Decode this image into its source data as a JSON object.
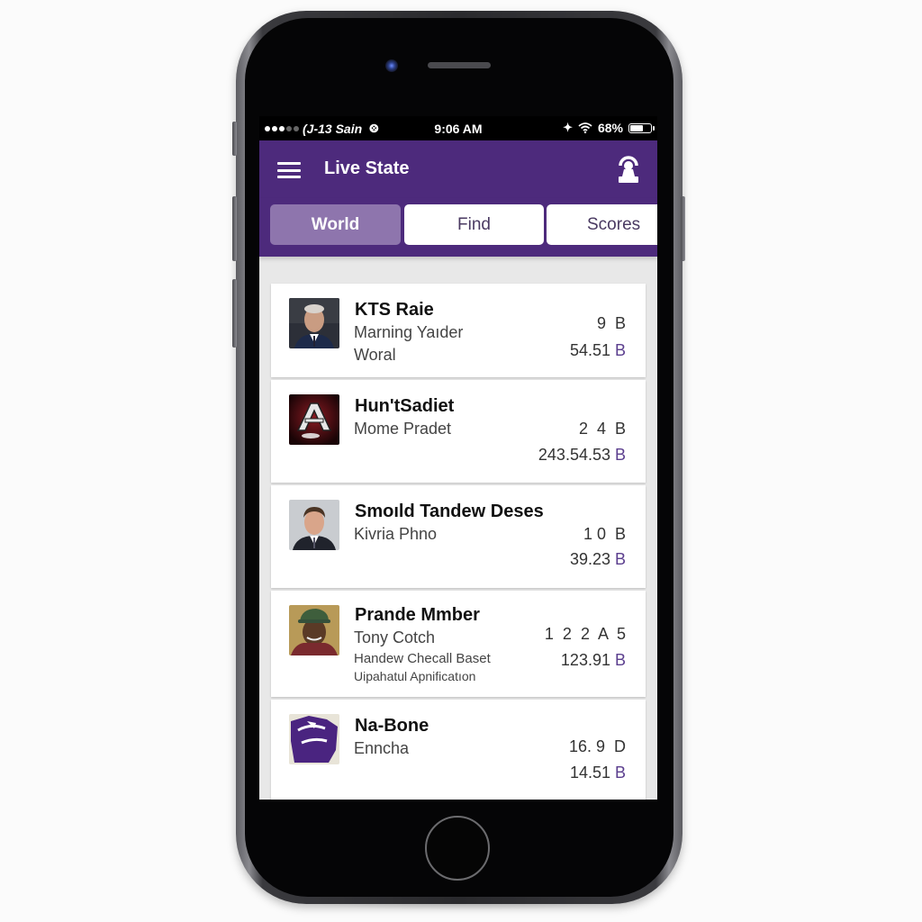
{
  "status_bar": {
    "signal_dots_full": 3,
    "signal_dots_total": 5,
    "carrier": "(J-13 Sain",
    "time": "9:06 AM",
    "battery_percent": "68%",
    "battery_level": 0.68
  },
  "app_bar": {
    "title": "Live State",
    "menu_icon": "hamburger-menu-icon",
    "right_icon": "profile-icon"
  },
  "tabs": [
    {
      "label": "World",
      "active": true
    },
    {
      "label": "Find",
      "active": false
    },
    {
      "label": "Scores",
      "active": false
    }
  ],
  "items": [
    {
      "title": "KTS Raie",
      "subtitle": "Marning Yaıder",
      "line3": "Woral",
      "line4": "",
      "stat_top": "9  ",
      "stat_top_unit": "B",
      "stat_bottom": "54.51 ",
      "stat_bottom_unit": "B",
      "avatar": "man-in-suit-photo"
    },
    {
      "title": "Hun'tSadiet",
      "subtitle": "Mome Pradet",
      "line3": "",
      "line4": "",
      "stat_top": "2  4  ",
      "stat_top_unit": "B",
      "stat_bottom": "243.54.53 ",
      "stat_bottom_unit": "B",
      "avatar": "team-logo-letter-a"
    },
    {
      "title": "Smoıld Tandew Deses",
      "subtitle": "Kivria Phno",
      "line3": "",
      "line4": "",
      "stat_top": "1 0  ",
      "stat_top_unit": "B",
      "stat_bottom": "39.23 ",
      "stat_bottom_unit": "B",
      "avatar": "man-in-suit-photo"
    },
    {
      "title": "Prande Mmber",
      "subtitle": "Tony Cotch",
      "line3": "Handew Checall Baset",
      "line4": "Uipahatul Apnificatıon",
      "stat_top": "1  2  2  A  5",
      "stat_top_unit": "",
      "stat_bottom": "123.91 ",
      "stat_bottom_unit": "B",
      "avatar": "man-in-cap-photo"
    },
    {
      "title": "Na-Bone",
      "subtitle": "Enncha",
      "line3": "",
      "line4": "",
      "stat_top": "16. 9  ",
      "stat_top_unit": "D",
      "stat_bottom": "14.51 ",
      "stat_bottom_unit": "B",
      "avatar": "purple-team-logo"
    }
  ],
  "colors": {
    "brand_purple": "#4d2a7c",
    "active_tab": "#8e75ad",
    "unit_accent": "#5b3e8e"
  }
}
